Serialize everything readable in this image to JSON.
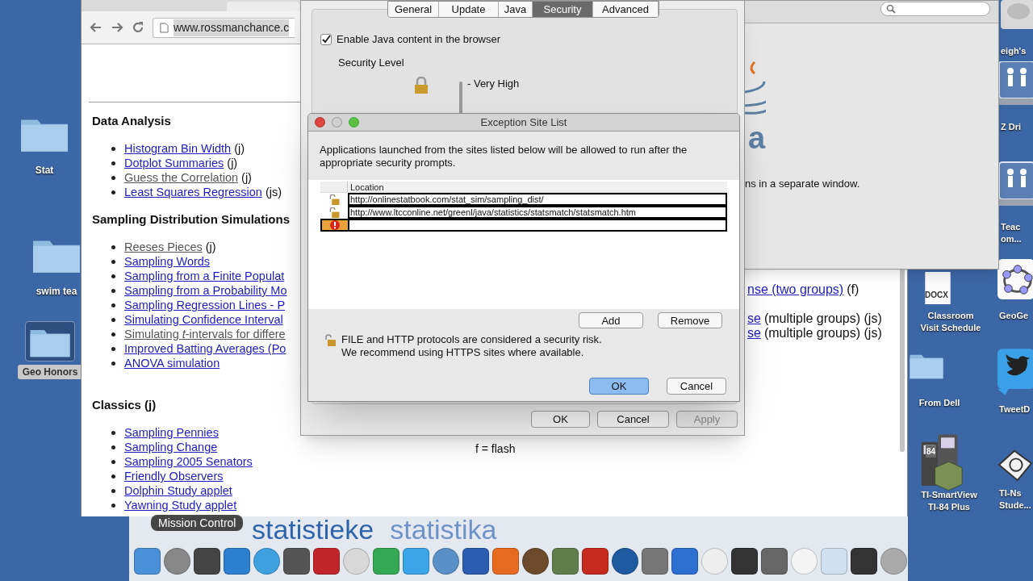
{
  "desktop_left": [
    {
      "label": "Stat",
      "selected": false
    },
    {
      "label": "swim tea",
      "selected": false
    },
    {
      "label": "Geo Honors",
      "selected": true
    }
  ],
  "desktop_right": [
    {
      "kind": "disk",
      "lines": [
        "eigh's"
      ]
    },
    {
      "kind": "network",
      "lines": [
        "Z Dri"
      ]
    },
    {
      "kind": "network",
      "lines": [
        "Teac",
        "om..."
      ]
    },
    {
      "kind": "document",
      "badge": "DOCX",
      "lines": [
        "Classroom",
        "Visit Schedule"
      ]
    },
    {
      "kind": "geometry",
      "lines": [
        "GeoGe"
      ]
    },
    {
      "kind": "folder",
      "lines": [
        "From Dell"
      ]
    },
    {
      "kind": "bird",
      "lines": [
        "TweetD"
      ]
    },
    {
      "kind": "calculator",
      "badge": "84",
      "lines": [
        "TI-SmartView",
        "TI-84 Plus"
      ]
    },
    {
      "kind": "nspire",
      "lines": [
        "TI-Ns",
        "Stude..."
      ]
    }
  ],
  "browser": {
    "address": "www.rossmanchance.c",
    "sections": [
      {
        "heading": "Data Analysis",
        "items": [
          {
            "link": "Histogram Bin Width",
            "note": "(j)",
            "visited": false
          },
          {
            "link": "Dotplot Summaries",
            "note": "(j)",
            "visited": false
          },
          {
            "link": "Guess the Correlation",
            "note": "(j)",
            "visited": true
          },
          {
            "link": "Least Squares Regression",
            "note": "(js)",
            "visited": false
          }
        ]
      },
      {
        "heading": "Sampling Distribution Simulations",
        "items": [
          {
            "link": "Reeses Pieces",
            "note": "(j)",
            "visited": true
          },
          {
            "link": "Sampling Words",
            "visited": false
          },
          {
            "link": "Sampling from a Finite Populat",
            "visited": false
          },
          {
            "link": "Sampling from a Probability Mo",
            "visited": false
          },
          {
            "link": "Sampling Regression Lines - P",
            "visited": false
          },
          {
            "link": "Simulating Confidence Interval",
            "visited": false
          },
          {
            "link": "Simulating *t*-intervals for differe",
            "visited": true
          },
          {
            "link": "Improved Batting Averages (Po",
            "visited": false
          },
          {
            "link": "ANOVA simulation",
            "visited": false
          }
        ]
      },
      {
        "heading": "Classics (j)",
        "items": [
          {
            "link": "Sampling Pennies",
            "visited": false
          },
          {
            "link": "Sampling Change",
            "visited": false
          },
          {
            "link": "Sampling 2005 Senators",
            "visited": false
          },
          {
            "link": "Friendly Observers",
            "visited": false
          },
          {
            "link": "Dolphin Study applet",
            "visited": false
          },
          {
            "link": "Yawning Study applet",
            "visited": false
          }
        ]
      }
    ],
    "right_items": [
      {
        "link": "nse (two groups)",
        "note": "(f)"
      },
      {
        "link": "se",
        "note": "(multiple groups) (js)"
      },
      {
        "link": "se",
        "note": "(multiple groups) (js)"
      }
    ],
    "legend": [
      "f = flash"
    ],
    "banner": [
      "statistieke",
      "statistika"
    ]
  },
  "preferences_window": {
    "logo_fragment": "a",
    "text_fragment": "ns in a separate window."
  },
  "java_panel": {
    "tabs": [
      {
        "label": "General",
        "selected": false
      },
      {
        "label": "Update",
        "selected": false
      },
      {
        "label": "Java",
        "selected": false
      },
      {
        "label": "Security",
        "selected": true
      },
      {
        "label": "Advanced",
        "selected": false
      }
    ],
    "enable_java": {
      "label": "Enable Java content in the browser",
      "checked": true
    },
    "security_level_label": "Security Level",
    "level_option": "- Very High",
    "buttons": [
      {
        "label": "OK",
        "disabled": false
      },
      {
        "label": "Cancel",
        "disabled": false
      },
      {
        "label": "Apply",
        "disabled": true
      }
    ]
  },
  "dialog": {
    "title": "Exception Site List",
    "description": "Applications launched from the sites listed below will be allowed to run after the appropriate security prompts.",
    "column": "Location",
    "rows": [
      {
        "kind": "site",
        "location": "http://onlinestatbook.com/stat_sim/sampling_dist/"
      },
      {
        "kind": "site",
        "location": "http://www.ltcconline.net/greenl/java/statistics/statsmatch/statsmatch.htm"
      },
      {
        "kind": "error"
      }
    ],
    "list_buttons": [
      "Add",
      "Remove"
    ],
    "warning": [
      "FILE and HTTP protocols are considered a security risk.",
      "We recommend using HTTPS sites where available."
    ],
    "buttons": [
      {
        "label": "OK",
        "default": true
      },
      {
        "label": "Cancel",
        "default": false
      }
    ]
  },
  "tooltip": "Mission Control"
}
